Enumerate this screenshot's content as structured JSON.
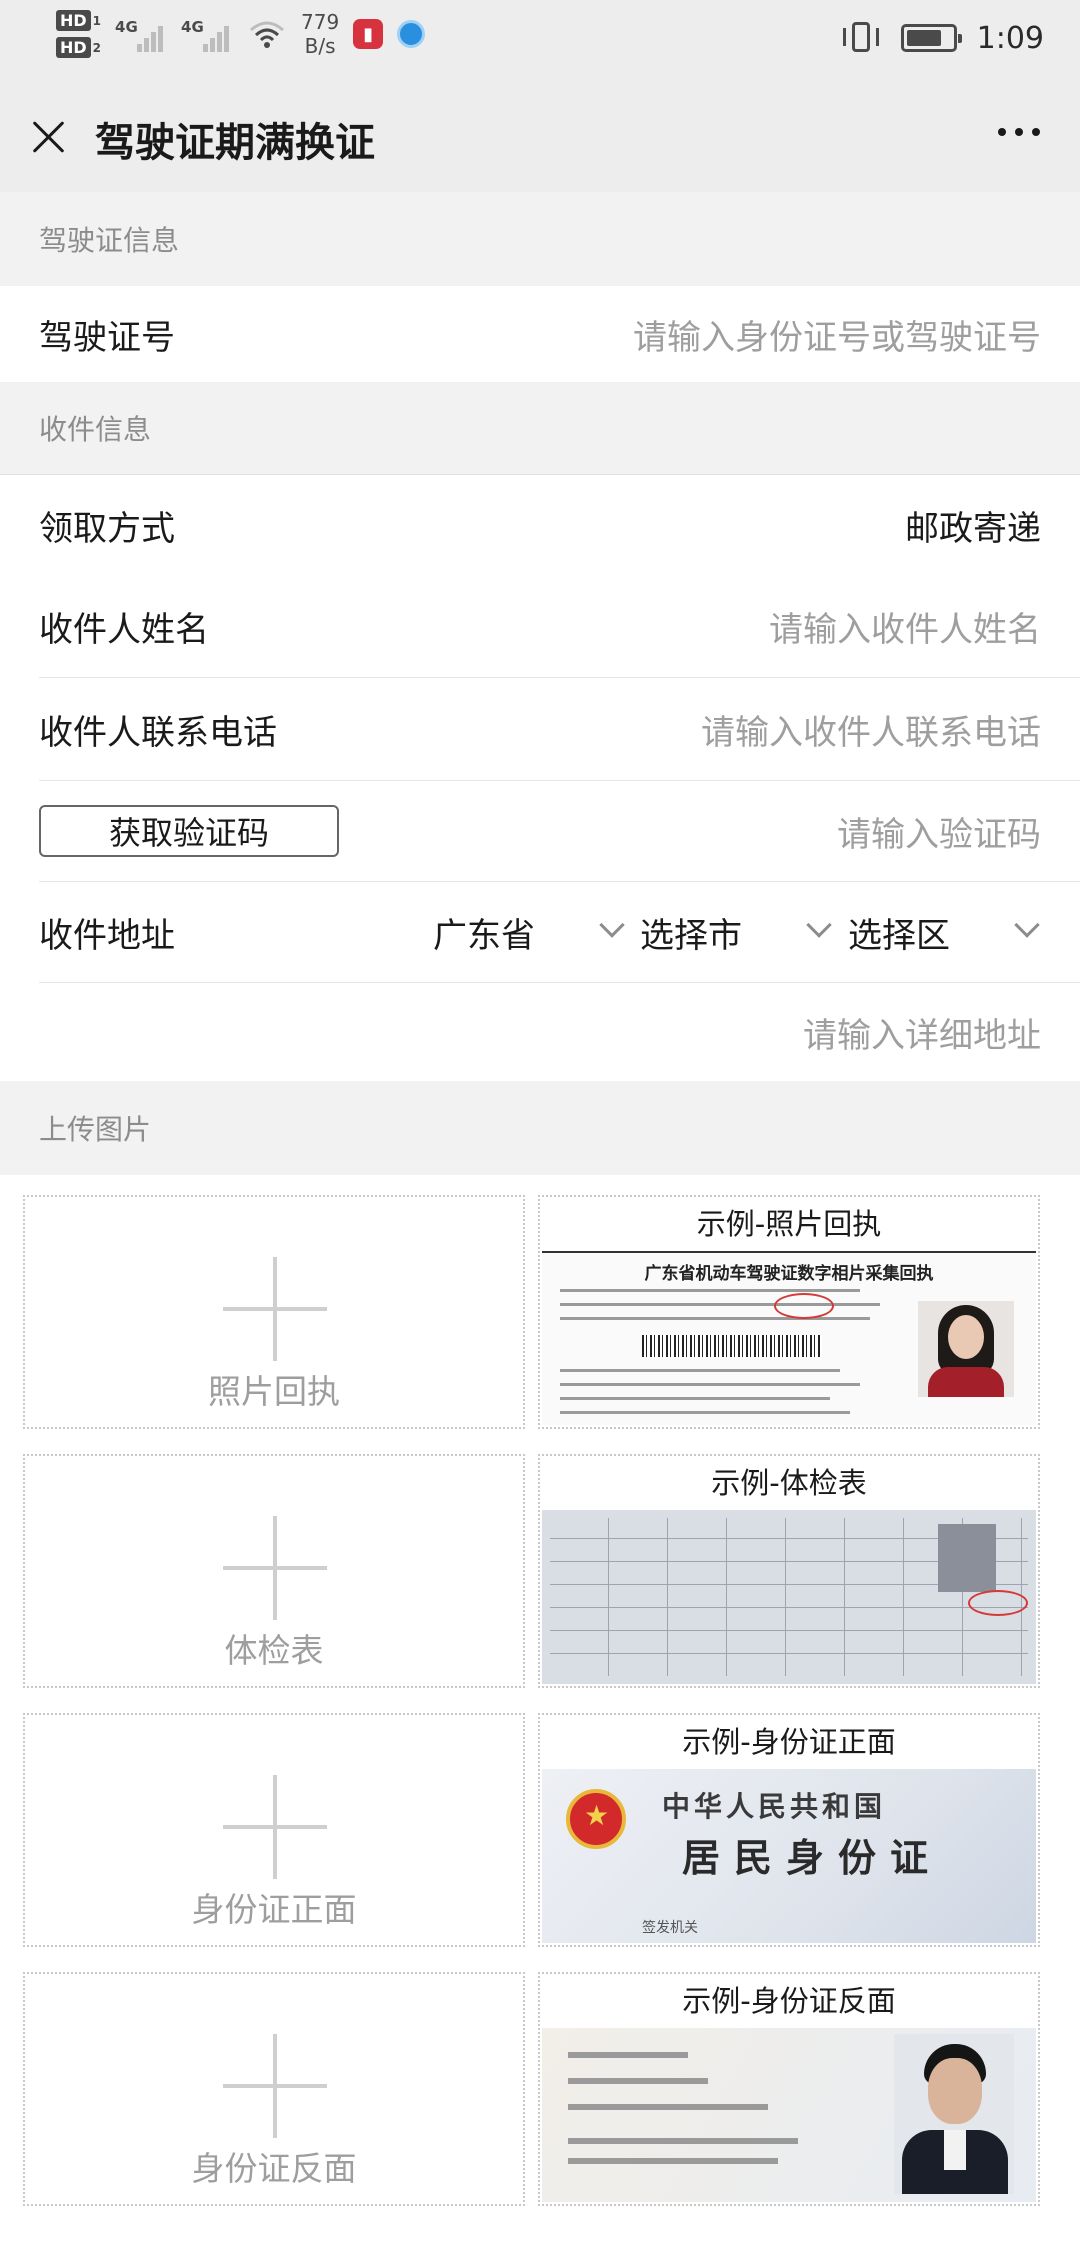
{
  "status_bar": {
    "hd1": "HD",
    "hd1_sub": "1",
    "hd2": "HD",
    "hd2_sub": "2",
    "net1": "4G",
    "net2": "4G",
    "speed_value": "779",
    "speed_unit": "B/s",
    "time": "1:09"
  },
  "title_bar": {
    "title": "驾驶证期满换证"
  },
  "sections": {
    "license_info": "驾驶证信息",
    "receive_info": "收件信息",
    "upload": "上传图片"
  },
  "license": {
    "label": "驾驶证号",
    "placeholder": "请输入身份证号或驾驶证号"
  },
  "receive": {
    "method_label": "领取方式",
    "method_value": "邮政寄递",
    "name_label": "收件人姓名",
    "name_placeholder": "请输入收件人姓名",
    "phone_label": "收件人联系电话",
    "phone_placeholder": "请输入收件人联系电话",
    "code_button": "获取验证码",
    "code_placeholder": "请输入验证码",
    "address_label": "收件地址",
    "province": "广东省",
    "city": "选择市",
    "district": "选择区",
    "detail_placeholder": "请输入详细地址"
  },
  "uploads": [
    {
      "label": "照片回执",
      "example_title": "示例-照片回执"
    },
    {
      "label": "体检表",
      "example_title": "示例-体检表"
    },
    {
      "label": "身份证正面",
      "example_title": "示例-身份证正面"
    },
    {
      "label": "身份证反面",
      "example_title": "示例-身份证反面"
    }
  ],
  "example_images": {
    "receipt_heading": "广东省机动车驾驶证数字相片采集回执",
    "id_front_line1": "中华人民共和国",
    "id_front_line2": "居民身份证",
    "id_front_issuer": "签发机关"
  }
}
